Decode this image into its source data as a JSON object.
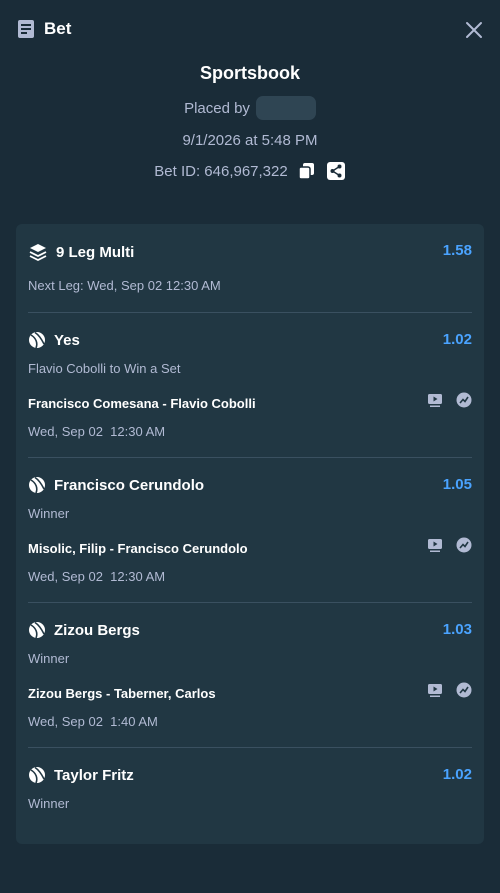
{
  "header": {
    "title": "Bet"
  },
  "summary": {
    "title": "Sportsbook",
    "placed_by_label": "Placed by",
    "datetime": "9/1/2026 at 5:48 PM",
    "bet_id": "Bet ID: 646,967,322"
  },
  "multi": {
    "title": "9 Leg Multi",
    "odds": "1.58",
    "next_leg": "Next Leg: Wed, Sep 02 12:30 AM"
  },
  "legs": [
    {
      "selection": "Yes",
      "odds": "1.02",
      "market": "Flavio Cobolli to Win a Set",
      "event": "Francisco Comesana - Flavio Cobolli",
      "time": "Wed, Sep 02  12:30 AM"
    },
    {
      "selection": "Francisco Cerundolo",
      "odds": "1.05",
      "market": "Winner",
      "event": "Misolic, Filip - Francisco Cerundolo",
      "time": "Wed, Sep 02  12:30 AM"
    },
    {
      "selection": "Zizou Bergs",
      "odds": "1.03",
      "market": "Winner",
      "event": "Zizou Bergs - Taberner, Carlos",
      "time": "Wed, Sep 02  1:40 AM"
    },
    {
      "selection": "Taylor Fritz",
      "odds": "1.02",
      "market": "Winner",
      "event": "",
      "time": ""
    }
  ],
  "icons": {
    "header": "receipt-icon",
    "close": "close-icon",
    "copy": "copy-icon",
    "share": "share-icon",
    "multi": "layers-icon",
    "sport": "tennis-ball-icon",
    "live": "live-stream-icon",
    "stats": "stats-icon"
  },
  "colors": {
    "background": "#1a2c38",
    "card": "#213743",
    "odds": "#4aa3ff",
    "muted_text": "#b1bad3"
  }
}
